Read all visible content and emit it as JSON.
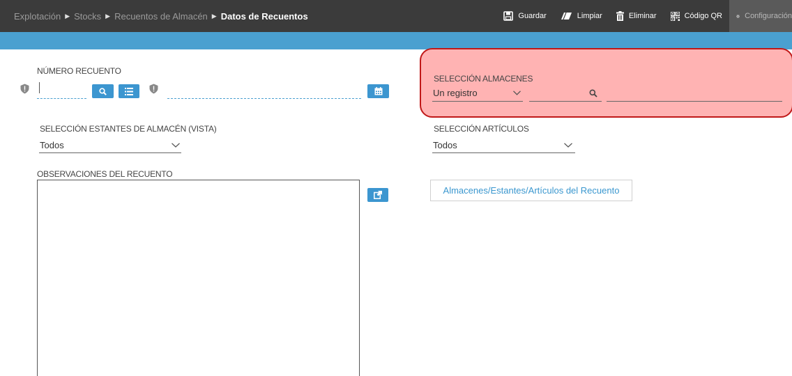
{
  "breadcrumb": {
    "items": [
      "Explotación",
      "Stocks",
      "Recuentos de Almacén"
    ],
    "current": "Datos de Recuentos"
  },
  "toolbar": {
    "save": "Guardar",
    "clear": "Limpiar",
    "delete": "Eliminar",
    "qr": "Código QR",
    "config": "Configuración"
  },
  "form": {
    "numero_recuento": {
      "label": "NÚMERO RECUENTO",
      "value": "",
      "description": ""
    },
    "seleccion_almacenes": {
      "label": "SELECCIÓN ALMACENES",
      "mode": "Un registro",
      "code": "",
      "name": ""
    },
    "seleccion_estantes": {
      "label": "SELECCIÓN ESTANTES DE ALMACÉN (VISTA)",
      "value": "Todos"
    },
    "seleccion_articulos": {
      "label": "SELECCIÓN ARTÍCULOS",
      "value": "Todos"
    },
    "observaciones": {
      "label": "OBSERVACIONES DEL RECUENTO",
      "value": ""
    },
    "link_button": "Almacenes/Estantes/Artículos del Recuento"
  },
  "colors": {
    "topbar": "#3b3b3b",
    "accent_blue": "#4aa0d0",
    "button_blue": "#3c96d0",
    "highlight_fill": "#ffb3b3",
    "highlight_border": "#c01818"
  }
}
